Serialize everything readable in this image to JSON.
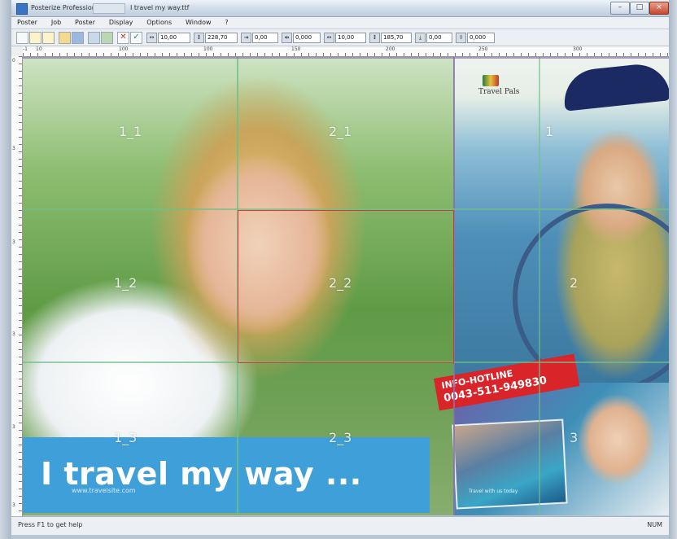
{
  "title": {
    "app": "Posterize Professional",
    "doc": "I travel my way.ttf"
  },
  "window_controls": {
    "minimize": "–",
    "maximize": "□",
    "close": "×"
  },
  "menu": [
    "Poster",
    "Job",
    "Poster",
    "Display",
    "Options",
    "Window",
    "?"
  ],
  "toolbar": {
    "fields": [
      "10,00",
      "228,70",
      "0,00",
      "0,000",
      "10,00",
      "185,70",
      "0,00",
      "0,000"
    ]
  },
  "ruler": {
    "top": [
      "-1",
      "10",
      "100",
      "100",
      "150",
      "200",
      "250",
      "300"
    ],
    "left": [
      "0",
      "3",
      "3",
      "3",
      "3",
      "3"
    ]
  },
  "canvas": {
    "tiles": [
      "1_1",
      "2_1",
      "1_2",
      "2_2",
      "1_3",
      "2_3",
      "1",
      "2",
      "3"
    ],
    "banner_text": "I travel my way ...",
    "banner_url": "www.travelsite.com",
    "hotline_title": "INFO-HOTLINE",
    "hotline_number": "0043-511-949830",
    "logo_text": "Travel Pals",
    "brochure_text": "Travel with us today"
  },
  "status": {
    "left": "Press F1 to get help",
    "right": "NUM"
  },
  "colors": {
    "grid_green": "#6fbf8a",
    "grid_purple": "#8a6fae",
    "selection_red": "#d33b3b",
    "banner_blue": "#3f9fd9",
    "hotline_red": "#d9242a"
  }
}
